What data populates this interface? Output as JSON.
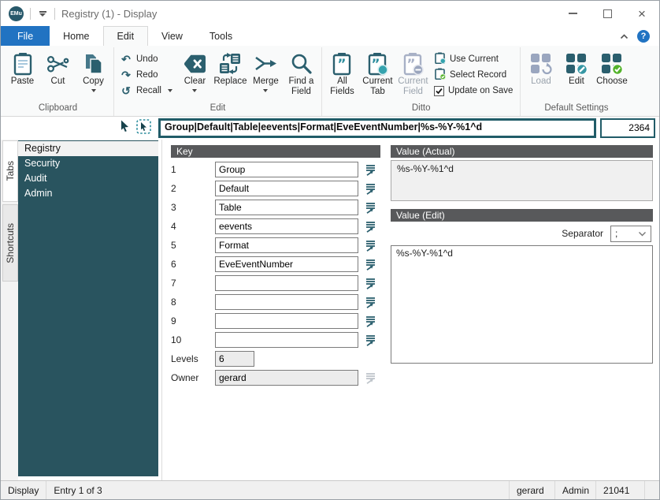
{
  "colors": {
    "teal_panel": "#29545f",
    "teal_icon": "#2b5f6e",
    "teal_bar": "#215c68",
    "accent_blue": "#2173c2",
    "green": "#54b32c",
    "header_gray": "#58595b"
  },
  "titlebar": {
    "logo": "EMu",
    "title": "Registry (1) - Display"
  },
  "ribbon_tabs": {
    "file": "File",
    "home": "Home",
    "edit": "Edit",
    "view": "View",
    "tools": "Tools"
  },
  "ribbon": {
    "clipboard": {
      "label": "Clipboard",
      "paste": "Paste",
      "cut": "Cut",
      "copy": "Copy"
    },
    "edit": {
      "label": "Edit",
      "undo": "Undo",
      "redo": "Redo",
      "recall": "Recall",
      "clear": "Clear",
      "replace": "Replace",
      "merge": "Merge",
      "find_a_field": "Find a\nField"
    },
    "ditto": {
      "label": "Ditto",
      "all_fields": "All\nFields",
      "current_tab": "Current\nTab",
      "current_field": "Current\nField",
      "use_current": "Use Current",
      "select_record": "Select Record",
      "update_on_save": "Update on Save"
    },
    "default_settings": {
      "label": "Default Settings",
      "load": "Load",
      "edit": "Edit",
      "choose": "Choose"
    }
  },
  "pathbar": {
    "path": "Group|Default|Table|eevents|Format|EveEventNumber|%s-%Y-%1^d",
    "count": "2364"
  },
  "sidebar": {
    "tabs_tab": "Tabs",
    "shortcuts_tab": "Shortcuts",
    "items": [
      {
        "label": "Registry"
      },
      {
        "label": "Security"
      },
      {
        "label": "Audit"
      },
      {
        "label": "Admin"
      }
    ]
  },
  "key_panel": {
    "header": "Key",
    "rows": [
      {
        "num": "1",
        "value": "Group"
      },
      {
        "num": "2",
        "value": "Default"
      },
      {
        "num": "3",
        "value": "Table"
      },
      {
        "num": "4",
        "value": "eevents"
      },
      {
        "num": "5",
        "value": "Format"
      },
      {
        "num": "6",
        "value": "EveEventNumber"
      },
      {
        "num": "7",
        "value": ""
      },
      {
        "num": "8",
        "value": ""
      },
      {
        "num": "9",
        "value": ""
      },
      {
        "num": "10",
        "value": ""
      }
    ],
    "levels_label": "Levels",
    "levels_value": "6",
    "owner_label": "Owner",
    "owner_value": "gerard"
  },
  "value_actual": {
    "header": "Value (Actual)",
    "text": "%s-%Y-%1^d"
  },
  "value_edit": {
    "header": "Value (Edit)",
    "separator_label": "Separator",
    "separator_value": ";",
    "text": "%s-%Y-%1^d"
  },
  "statusbar": {
    "mode": "Display",
    "entry": "Entry 1 of 3",
    "user": "gerard",
    "group": "Admin",
    "record": "21041"
  }
}
